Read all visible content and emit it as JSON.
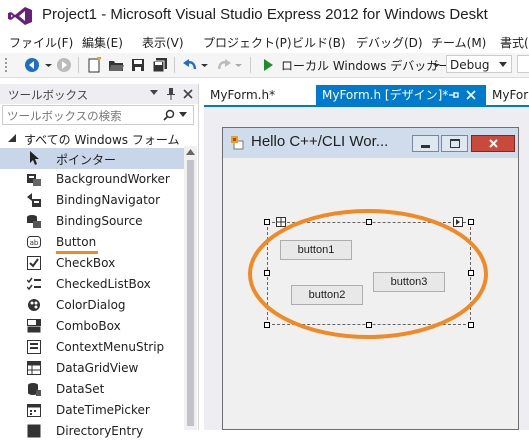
{
  "window": {
    "title": "Project1 - Microsoft Visual Studio Express 2012 for Windows Deskt"
  },
  "menu": {
    "items": [
      "ファイル(F)",
      "編集(E)",
      "表示(V)",
      "プロジェクト(P)",
      "ビルド(B)",
      "デバッグ(D)",
      "チーム(M)",
      "書式("
    ]
  },
  "toolbar": {
    "run_label": "ローカル Windows デバッガー",
    "config_value": "Debug"
  },
  "toolbox": {
    "title": "ツールボックス",
    "search_placeholder": "ツールボックスの検索",
    "category": "すべての Windows フォーム",
    "items": [
      {
        "label": "ポインター",
        "icon": "pointer-icon"
      },
      {
        "label": "BackgroundWorker",
        "icon": "backgroundworker-icon"
      },
      {
        "label": "BindingNavigator",
        "icon": "bindingnavigator-icon"
      },
      {
        "label": "BindingSource",
        "icon": "bindingsource-icon"
      },
      {
        "label": "Button",
        "icon": "button-icon"
      },
      {
        "label": "CheckBox",
        "icon": "checkbox-icon"
      },
      {
        "label": "CheckedListBox",
        "icon": "checkedlistbox-icon"
      },
      {
        "label": "ColorDialog",
        "icon": "colordialog-icon"
      },
      {
        "label": "ComboBox",
        "icon": "combobox-icon"
      },
      {
        "label": "ContextMenuStrip",
        "icon": "contextmenustrip-icon"
      },
      {
        "label": "DataGridView",
        "icon": "datagridview-icon"
      },
      {
        "label": "DataSet",
        "icon": "dataset-icon"
      },
      {
        "label": "DateTimePicker",
        "icon": "datetimepicker-icon"
      },
      {
        "label": "DirectoryEntry",
        "icon": "directoryentry-icon"
      }
    ]
  },
  "tabs": [
    {
      "label": "MyForm.h*",
      "active": false
    },
    {
      "label": "MyForm.h [デザイン]*",
      "active": true
    },
    {
      "label": "MyForm",
      "active": false
    }
  ],
  "form": {
    "title": "Hello C++/CLI Wor...",
    "buttons": [
      "button1",
      "button2",
      "button3"
    ]
  },
  "colors": {
    "accent": "#007acc",
    "highlight_orange": "#f08a24",
    "selection": "#c9d6ea",
    "run_green": "#1e8c2e"
  }
}
